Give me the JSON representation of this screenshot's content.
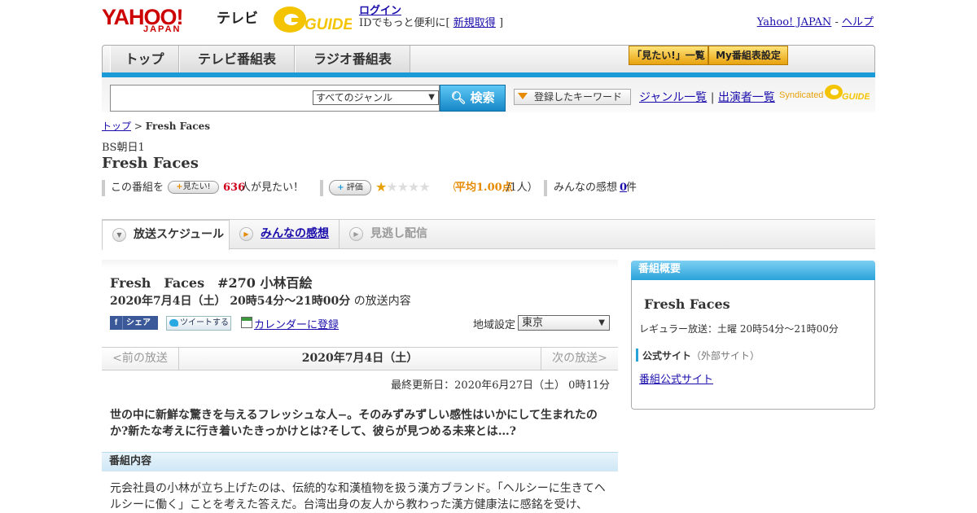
{
  "header": {
    "yahoo": "YAHOO!",
    "japan": "JAPAN",
    "tv": "テレビ",
    "gguide": "GUIDE",
    "login": "ログイン",
    "id_text_1": "IDでもっと便利に[",
    "signup": "新規取得",
    "id_text_2": "]",
    "yahoo_japan_link": "Yahoo! JAPAN",
    "sep": " - ",
    "help": "ヘルプ"
  },
  "nav": {
    "tabs": [
      "トップ",
      "テレビ番組表",
      "ラジオ番組表"
    ],
    "mitai_list": "「見たい!」一覧",
    "my_guide": "My番組表設定"
  },
  "search": {
    "genre": "すべてのジャンル",
    "button": "検索",
    "keyword_button": "登録したキーワード",
    "genre_list": "ジャンル一覧",
    "divider": "|",
    "cast_list": "出演者一覧",
    "syndicated": "Syndicated"
  },
  "breadcrumb": {
    "top": "トップ",
    "sep": " > ",
    "current": "Fresh Faces"
  },
  "program": {
    "channel": "BS朝日1",
    "title": "Fresh Faces"
  },
  "stats": {
    "pre": "この番組を",
    "mitai_button": "見たい!",
    "count": "636",
    "count_suffix": "人が見たい！",
    "rating_button": "評価",
    "rating_value": 1,
    "rating_max": 5,
    "avg_open": "（",
    "avg": "平均1.00点",
    "avg_suffix": "/1人）",
    "impressions_label": "みんなの感想",
    "impressions_count": "0",
    "impressions_suffix": "件"
  },
  "tabs": {
    "schedule": "放送スケジュール",
    "impressions": "みんなの感想",
    "missed": "見逃し配信"
  },
  "episode": {
    "title": "Fresh　Faces　#270 小林百絵",
    "date": "2020年7月4日（土）  20時54分～21時00分",
    "date_suffix": "の放送内容",
    "share": "シェア",
    "tweet": "ツイートする",
    "calendar": "カレンダーに登録",
    "region_label": "地域設定",
    "region": "東京"
  },
  "pager": {
    "prev": "<前の放送",
    "date": "2020年7月4日（土）",
    "next": "次の放送>"
  },
  "updated": "最終更新日：2020年6月27日（土）  0時11分",
  "summary": "世の中に新鮮な驚きを与えるフレッシュな人−。そのみずみずしい感性はいかにして生まれたのか?新たな考えに行き着いたきっかけとは?そして、彼らが見つめる未来とは…?",
  "section": {
    "heading": "番組内容",
    "body": "元会社員の小林が立ち上げたのは、伝統的な和漢植物を扱う漢方ブランド。「ヘルシーに生きてヘルシーに働く」ことを考えた答えだ。台湾出身の友人から教わった漢方健康法に感銘を受け、"
  },
  "sidebar": {
    "heading": "番組概要",
    "title": "Fresh Faces",
    "regular": "レギュラー放送：土曜 20時54分～21時00分",
    "official_label": "公式サイト",
    "official_note": "（外部サイト）",
    "official_link": "番組公式サイト"
  },
  "colors": {
    "accent_blue": "#1a9bd7",
    "count_red": "#d0021b",
    "rating_orange": "#e68a00",
    "link": "#1a0dab"
  }
}
